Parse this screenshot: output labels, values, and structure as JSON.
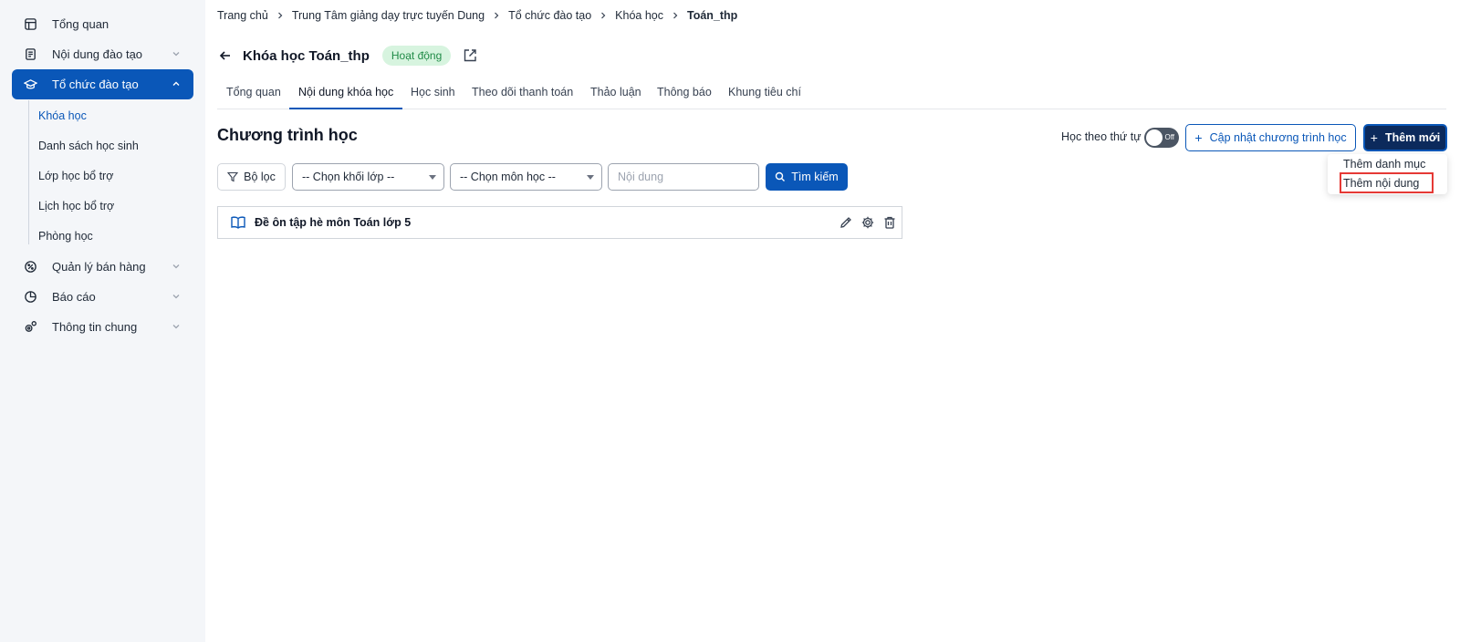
{
  "sidebar": {
    "items": [
      {
        "label": "Tổng quan",
        "icon": "dashboard-icon"
      },
      {
        "label": "Nội dung đào tạo",
        "icon": "content-icon"
      },
      {
        "label": "Tổ chức đào tạo",
        "icon": "graduation-cap-icon"
      },
      {
        "label": "Quản lý bán hàng",
        "icon": "sales-icon"
      },
      {
        "label": "Báo cáo",
        "icon": "pie-chart-icon"
      },
      {
        "label": "Thông tin chung",
        "icon": "settings-icon"
      }
    ],
    "sub_items": [
      "Khóa học",
      "Danh sách học sinh",
      "Lớp học bổ trợ",
      "Lịch học bổ trợ",
      "Phòng học"
    ]
  },
  "breadcrumb": [
    "Trang chủ",
    "Trung Tâm giảng dạy trực tuyến Dung",
    "Tổ chức đào tạo",
    "Khóa học",
    "Toán_thp"
  ],
  "header": {
    "title": "Khóa học Toán_thp",
    "status": "Hoạt động"
  },
  "tabs": [
    "Tổng quan",
    "Nội dung khóa học",
    "Học sinh",
    "Theo dõi thanh toán",
    "Thảo luận",
    "Thông báo",
    "Khung tiêu chí"
  ],
  "main": {
    "section_title": "Chương trình học",
    "order_label": "Học theo thứ tự",
    "toggle_text": "Off",
    "update_button": "Cập nhật chương trình học",
    "add_button": "Thêm mới",
    "dropdown": [
      "Thêm danh mục",
      "Thêm nội dung"
    ]
  },
  "filters": {
    "filter_button": "Bộ lọc",
    "grade_select": "-- Chọn khối lớp --",
    "subject_select": "-- Chọn môn học --",
    "content_placeholder": "Nội dung",
    "search_button": "Tìm kiếm"
  },
  "content": {
    "items": [
      {
        "label": "Đề ôn tập hè môn Toán lớp 5"
      }
    ]
  },
  "colors": {
    "primary": "#0a57b8",
    "dark_button": "#0c2a5c",
    "badge_bg": "#d7f4df",
    "badge_text": "#1f8a46",
    "highlight": "#e53935"
  }
}
